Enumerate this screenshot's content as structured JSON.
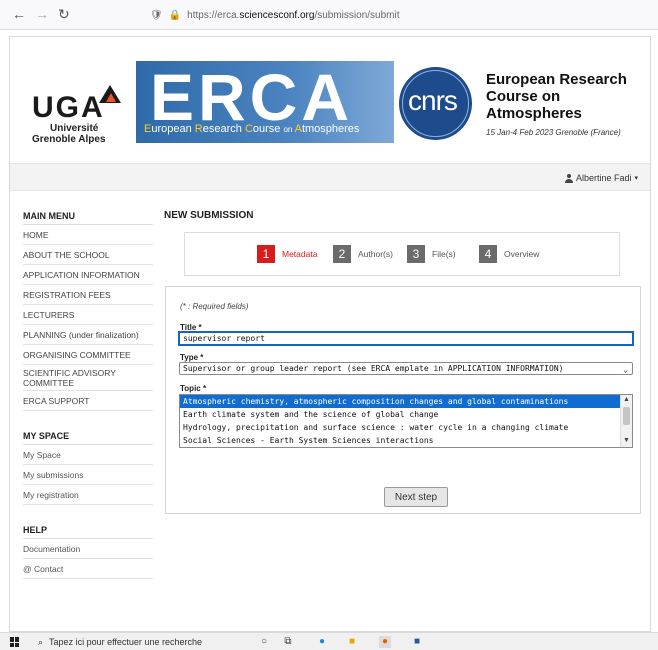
{
  "browser": {
    "url_prefix": "https://erca.",
    "url_domain": "sciencesconf.org",
    "url_path": "/submission/submit"
  },
  "header": {
    "uga_title": "UGA",
    "uga_sub1": "Université",
    "uga_sub2": "Grenoble Alpes",
    "erca_big": "ERCA",
    "erca_words": [
      "E",
      "uropean ",
      "R",
      "esearch ",
      "C",
      "ourse ",
      "on ",
      "A",
      "tmospheres"
    ],
    "cnrs": "cnrs",
    "course_title": "European Research Course on Atmospheres",
    "course_date": "15 Jan-4 Feb 2023 Grenoble (France)"
  },
  "user": {
    "name": "Albertine Fadi"
  },
  "sidebar": {
    "main_menu_title": "MAIN MENU",
    "main_menu": [
      "HOME",
      "ABOUT THE SCHOOL",
      "APPLICATION INFORMATION",
      "REGISTRATION FEES",
      "LECTURERS",
      "PLANNING (under finalization)",
      "ORGANISING COMMITTEE",
      "SCIENTIFIC ADVISORY COMMITTEE",
      "ERCA SUPPORT"
    ],
    "my_space_title": "MY SPACE",
    "my_space": [
      "My Space",
      "My submissions",
      "My registration"
    ],
    "help_title": "HELP",
    "help": [
      "Documentation",
      "@ Contact"
    ]
  },
  "main": {
    "title": "NEW SUBMISSION",
    "steps": [
      {
        "num": "1",
        "label": "Metadata"
      },
      {
        "num": "2",
        "label": "Author(s)"
      },
      {
        "num": "3",
        "label": "File(s)"
      },
      {
        "num": "4",
        "label": "Overview"
      }
    ],
    "required_note": "(* : Required fields)",
    "title_label": "Title *",
    "title_value": "supervisor report",
    "type_label": "Type *",
    "type_value": "Supervisor or group leader report (see ERCA emplate in APPLICATION INFORMATION)",
    "topic_label": "Topic *",
    "topics": [
      "Atmospheric chemistry, atmospheric composition changes and global contaminations",
      "Earth climate system and the science of global change",
      "Hydrology, precipitation and surface science : water cycle in a changing climate",
      "Social Sciences - Earth System Sciences interactions"
    ],
    "next_button": "Next step"
  },
  "taskbar": {
    "search_placeholder": "Tapez ici pour effectuer une recherche"
  },
  "colors": {
    "active_step": "#d81b1b",
    "select_highlight": "#0f6dd1",
    "erca_blue": "#2f6aa8",
    "cnrs_blue": "#1e4b8c"
  }
}
